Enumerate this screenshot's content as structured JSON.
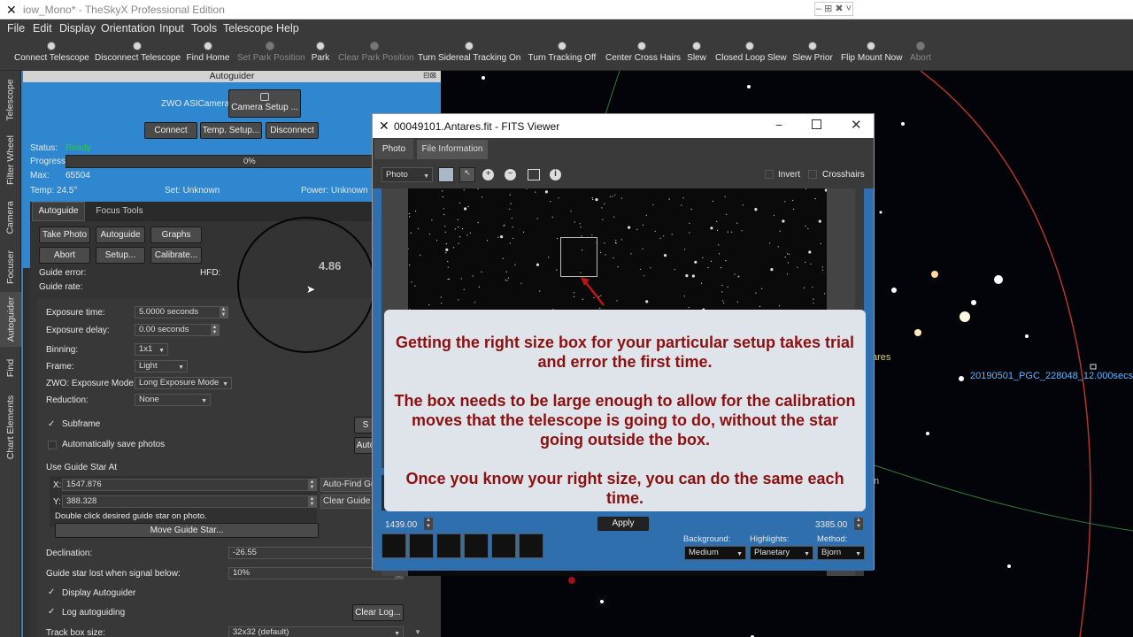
{
  "window": {
    "title": "iow_Mono* - TheSkyX Professional Edition",
    "controls": "‒ ⊞ ✖ ˅"
  },
  "menu": [
    "File",
    "Edit",
    "Display",
    "Orientation",
    "Input",
    "Tools",
    "Telescope",
    "Help"
  ],
  "toolbar": [
    {
      "label": "Connect Telescope",
      "enabled": true
    },
    {
      "label": "Disconnect Telescope",
      "enabled": true
    },
    {
      "label": "Find Home",
      "enabled": true
    },
    {
      "label": "Set Park Position",
      "enabled": false
    },
    {
      "label": "Park",
      "enabled": true
    },
    {
      "label": "Clear Park Position",
      "enabled": false
    },
    {
      "label": "Turn Sidereal Tracking On",
      "enabled": true
    },
    {
      "label": "Turn Tracking Off",
      "enabled": true
    },
    {
      "label": "Center Cross Hairs",
      "enabled": true
    },
    {
      "label": "Slew",
      "enabled": true
    },
    {
      "label": "Closed Loop Slew",
      "enabled": true
    },
    {
      "label": "Slew Prior",
      "enabled": true
    },
    {
      "label": "Flip Mount Now",
      "enabled": true
    },
    {
      "label": "Abort",
      "enabled": false
    }
  ],
  "side_tabs": [
    "Telescope",
    "Filter Wheel",
    "Camera",
    "Focuser",
    "Autoguider",
    "Find",
    "Chart Elements"
  ],
  "autoguider": {
    "title": "Autoguider",
    "camera_name": "ZWO ASICamera",
    "camera_setup": "Camera Setup ...",
    "connect": "Connect",
    "temp_setup": "Temp. Setup...",
    "disconnect": "Disconnect",
    "status_label": "Status:",
    "status_value": "Ready",
    "progress_label": "Progress:",
    "progress_value": "0%",
    "progress_fraction": 0,
    "max_label": "Max:",
    "max_value": "65504",
    "temp": "Temp: 24.5°",
    "set": "Set: Unknown",
    "power": "Power: Unknown",
    "tabs": [
      "Autoguide",
      "Focus Tools"
    ],
    "btn_take_photo": "Take Photo",
    "btn_autoguide": "Autoguide",
    "btn_graphs": "Graphs",
    "btn_abort": "Abort",
    "btn_setup": "Setup...",
    "btn_calibrate": "Calibrate...",
    "guide_error": "Guide error:",
    "hfd": "HFD:",
    "guide_rate": "Guide rate:",
    "hfd_value": "4.86",
    "exposure_time_label": "Exposure time:",
    "exposure_time": "5.0000 seconds",
    "exposure_delay_label": "Exposure delay:",
    "exposure_delay": "0.00 seconds",
    "binning_label": "Binning:",
    "binning": "1x1",
    "frame_label": "Frame:",
    "frame": "Light",
    "zwo_mode_label": "ZWO: Exposure Mode:",
    "zwo_mode": "Long Exposure Mode",
    "reduction_label": "Reduction:",
    "reduction": "None",
    "subframe": "Subframe",
    "auto_save": "Automatically save photos",
    "s_btn": "S",
    "auto_btn": "Auto",
    "use_guide_star": "Use Guide Star At",
    "x_label": "X:",
    "x_value": "1547.876",
    "y_label": "Y:",
    "y_value": "388.328",
    "auto_find": "Auto-Find Gui",
    "clear_guide": "Clear Guide S",
    "dbl_click": "Double click desired guide star on photo.",
    "move_guide": "Move Guide Star...",
    "declination_label": "Declination:",
    "declination": "-26.55",
    "lost_label": "Guide star lost when signal below:",
    "lost_value": "10%",
    "display_ag": "Display Autoguider",
    "log_ag": "Log autoguiding",
    "clear_log": "Clear Log...",
    "trackbox_label": "Track box size:",
    "trackbox": "32x32 (default)"
  },
  "fits": {
    "title": "00049101.Antares.fit - FITS Viewer",
    "tabs": [
      "Photo",
      "File Information"
    ],
    "view_mode": "Photo",
    "invert": "Invert",
    "crosshairs": "Crosshairs",
    "lower_value": "1439.00",
    "apply": "Apply",
    "upper_value": "3385.00",
    "background_label": "Background:",
    "background": "Medium",
    "highlights_label": "Highlights:",
    "highlights": "Planetary",
    "method_label": "Method:",
    "method": "Bjorn"
  },
  "sky": {
    "label_antares": "ares",
    "label_pgc": "20190501_PGC_228048_12.000secs_",
    "label_n": "n"
  },
  "callout": {
    "p1": "Getting the right size box for your particular setup takes trial and error the first time.",
    "p2": "The box needs to be large enough to allow for the calibration moves that the telescope is going to do, without the star going outside the box.",
    "p3": "Once you know your right size, you can do the same each time."
  },
  "colors": {
    "accent": "#2e87cf",
    "status_ready": "#22c422",
    "callout_text": "#8c1010"
  }
}
